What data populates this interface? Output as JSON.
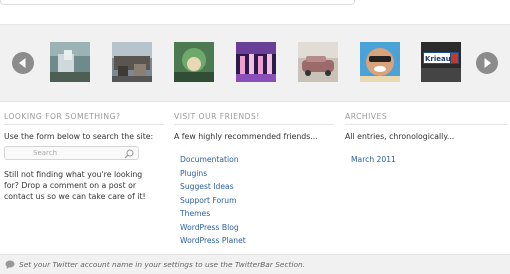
{
  "gallery": {
    "thumbnails": [
      {
        "name": "thumb-1"
      },
      {
        "name": "thumb-2"
      },
      {
        "name": "thumb-3"
      },
      {
        "name": "thumb-4"
      },
      {
        "name": "thumb-5"
      },
      {
        "name": "thumb-6"
      },
      {
        "name": "thumb-7",
        "sign_text": "Krieau"
      }
    ]
  },
  "search_section": {
    "heading": "LOOKING FOR SOMETHING?",
    "intro": "Use the form below to search the site:",
    "placeholder": "Search",
    "note": "Still not finding what you're looking for? Drop a comment on a post or contact us so we can take care of it!"
  },
  "friends_section": {
    "heading": "VISIT OUR FRIENDS!",
    "intro": "A few highly recommended friends...",
    "links": [
      "Documentation",
      "Plugins",
      "Suggest Ideas",
      "Support Forum",
      "Themes",
      "WordPress Blog",
      "WordPress Planet"
    ]
  },
  "archives_section": {
    "heading": "ARCHIVES",
    "intro": "All entries, chronologically...",
    "links": [
      "March 2011"
    ]
  },
  "footer": {
    "twitter_text": "Set your Twitter account name in your settings to use the TwitterBar Section."
  },
  "colors": {
    "link": "#2a5f9e",
    "gallery_bg": "#f1f1f1",
    "arrow": "#8c8c8c"
  }
}
